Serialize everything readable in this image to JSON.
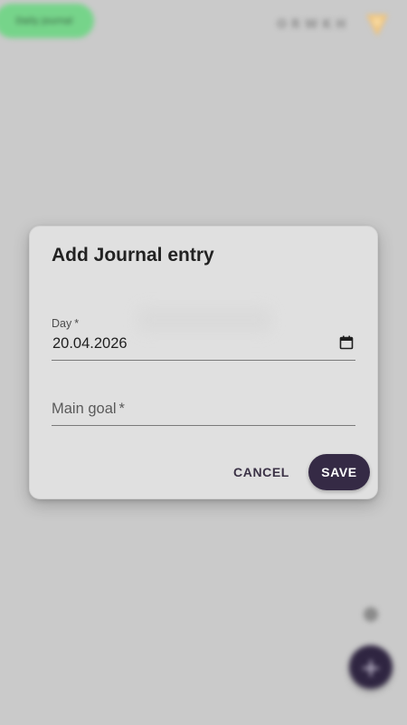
{
  "background": {
    "journal_button_label": "Daily journal",
    "brand_text": "ORWKH",
    "fab_icon": "plus-icon"
  },
  "dialog": {
    "title": "Add Journal entry",
    "fields": {
      "day": {
        "label": "Day",
        "required_mark": "*",
        "value": "20.04.2026",
        "icon": "calendar-icon"
      },
      "main_goal": {
        "label": "Main goal",
        "required_mark": "*",
        "value": ""
      }
    },
    "actions": {
      "cancel_label": "CANCEL",
      "save_label": "SAVE"
    }
  },
  "colors": {
    "scrim": "#cacaca",
    "dialog_bg": "#e0e0e0",
    "primary": "#352a45",
    "accent_green": "#76d48a",
    "logo_orange": "#f0c37a"
  }
}
